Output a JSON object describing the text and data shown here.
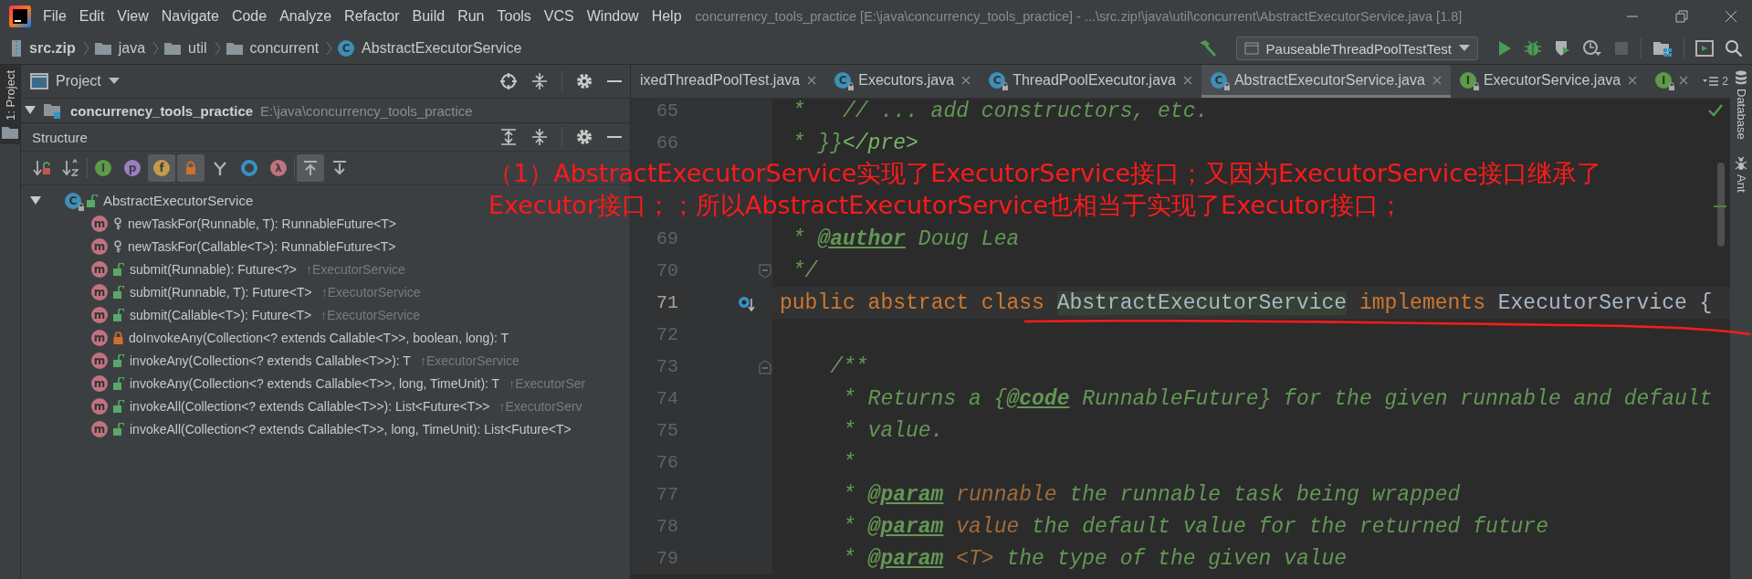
{
  "menu_bar": {
    "items": [
      "File",
      "Edit",
      "View",
      "Navigate",
      "Code",
      "Analyze",
      "Refactor",
      "Build",
      "Run",
      "Tools",
      "VCS",
      "Window",
      "Help"
    ],
    "title": "concurrency_tools_practice [E:\\java\\concurrency_tools_practice] - ...\\src.zip!\\java\\util\\concurrent\\AbstractExecutorService.java [1.8]"
  },
  "nav_bar": {
    "breadcrumbs": [
      {
        "kind": "archive",
        "label": "src.zip"
      },
      {
        "kind": "folder",
        "label": "java"
      },
      {
        "kind": "folder",
        "label": "util"
      },
      {
        "kind": "folder",
        "label": "concurrent"
      },
      {
        "kind": "class",
        "badge": "C",
        "label": "AbstractExecutorService"
      }
    ],
    "run_config": "PauseableThreadPoolTestTest"
  },
  "left_stripe": {
    "tabs": [
      {
        "label": "1: Project",
        "selected": true
      }
    ]
  },
  "project_panel": {
    "title": "Project",
    "root": {
      "name": "concurrency_tools_practice",
      "path": "E:\\java\\concurrency_tools_practice",
      "expanded": true
    }
  },
  "structure_panel": {
    "title": "Structure",
    "toolbar": [
      [
        {
          "kind": "sort-visibility",
          "on": false
        },
        {
          "kind": "sort-alpha",
          "on": false
        }
      ],
      [
        {
          "kind": "inherited",
          "badge": "I",
          "on": false
        },
        {
          "kind": "properties",
          "badge": "p",
          "on": false
        },
        {
          "kind": "fields",
          "badge": "f",
          "on": true
        },
        {
          "kind": "non-public",
          "on": true
        },
        {
          "kind": "anonymous",
          "on": false
        },
        {
          "kind": "ring",
          "on": false
        },
        {
          "kind": "lambdas",
          "badge": "λ",
          "on": false
        }
      ],
      [
        {
          "kind": "scroll-to-source",
          "on": true
        },
        {
          "kind": "scroll-from-source",
          "on": false
        }
      ]
    ],
    "tree": {
      "name": "AbstractExecutorService",
      "badge": "C",
      "expanded": true,
      "children": [
        {
          "badge": "m",
          "kind": "package",
          "name": "newTaskFor(Runnable, T): RunnableFuture<T>"
        },
        {
          "badge": "m",
          "kind": "package",
          "name": "newTaskFor(Callable<T>): RunnableFuture<T>"
        },
        {
          "badge": "m",
          "kind": "public",
          "name": "submit(Runnable): Future<?>",
          "inherited": "↑ExecutorService"
        },
        {
          "badge": "m",
          "kind": "public",
          "name": "submit(Runnable, T): Future<T>",
          "inherited": "↑ExecutorService"
        },
        {
          "badge": "m",
          "kind": "public",
          "name": "submit(Callable<T>): Future<T>",
          "inherited": "↑ExecutorService"
        },
        {
          "badge": "m",
          "kind": "private",
          "name": "doInvokeAny(Collection<? extends Callable<T>>, boolean, long): T"
        },
        {
          "badge": "m",
          "kind": "public",
          "name": "invokeAny(Collection<? extends Callable<T>>): T",
          "inherited": "↑ExecutorService"
        },
        {
          "badge": "m",
          "kind": "public",
          "name": "invokeAny(Collection<? extends Callable<T>>, long, TimeUnit): T",
          "inherited": "↑ExecutorSer"
        },
        {
          "badge": "m",
          "kind": "public",
          "name": "invokeAll(Collection<? extends Callable<T>>): List<Future<T>>",
          "inherited": "↑ExecutorServ"
        },
        {
          "badge": "m",
          "kind": "public",
          "name": "invokeAll(Collection<? extends Callable<T>>, long, TimeUnit): List<Future<T>"
        }
      ]
    }
  },
  "editor": {
    "tabs": [
      {
        "label": "ixedThreadPoolTest.java",
        "selected": false
      },
      {
        "kind": "class",
        "badge": "C",
        "label": "Executors.java",
        "selected": false
      },
      {
        "kind": "class",
        "badge": "C",
        "label": "ThreadPoolExecutor.java",
        "selected": false
      },
      {
        "kind": "class",
        "badge": "C",
        "label": "AbstractExecutorService.java",
        "selected": true
      },
      {
        "kind": "interface",
        "badge": "I",
        "label": "ExecutorService.java",
        "selected": false
      },
      {
        "kind": "interface",
        "badge": "I",
        "selected": false
      }
    ],
    "tab_overflow_count": "2",
    "lines": [
      {
        "number": "65",
        "segments": [
          {
            "kind": "comment",
            "text": " *   // ... add constructors, etc."
          }
        ]
      },
      {
        "number": "66",
        "segments": [
          {
            "kind": "comment",
            "text": " * }}"
          },
          {
            "kind": "markup",
            "text": "</pre>"
          }
        ]
      },
      {
        "covered": true
      },
      {
        "covered": true
      },
      {
        "number": "69",
        "segments": [
          {
            "kind": "comment",
            "text": " * "
          },
          {
            "kind": "doctag",
            "text": "@author"
          },
          {
            "kind": "comment",
            "text": " Doug Lea"
          }
        ]
      },
      {
        "number": "70",
        "fold": {
          "kind": "end"
        },
        "segments": [
          {
            "kind": "comment",
            "text": " */"
          }
        ]
      },
      {
        "number": "71",
        "current": true,
        "gutter_icon": {
          "kind": "implements"
        },
        "segments": [
          {
            "kind": "keyword",
            "text": "public abstract class "
          },
          {
            "kind": "declaration",
            "text": "AbstractExecutorService"
          },
          {
            "kind": "keyword",
            "text": " implements"
          },
          {
            "kind": "plain",
            "text": " ExecutorService {"
          }
        ]
      },
      {
        "number": "72"
      },
      {
        "number": "73",
        "fold": {
          "kind": "start"
        },
        "segments": [
          {
            "kind": "comment",
            "text": "    /**"
          }
        ]
      },
      {
        "number": "74",
        "segments": [
          {
            "kind": "comment",
            "text": "     * Returns a {"
          },
          {
            "kind": "doctag",
            "text": "@code"
          },
          {
            "kind": "comment",
            "text": " RunnableFuture} for the given runnable and default"
          }
        ]
      },
      {
        "number": "75",
        "segments": [
          {
            "kind": "comment",
            "text": "     * value."
          }
        ]
      },
      {
        "number": "76",
        "segments": [
          {
            "kind": "comment",
            "text": "     *"
          }
        ]
      },
      {
        "number": "77",
        "segments": [
          {
            "kind": "comment",
            "text": "     * "
          },
          {
            "kind": "doctag",
            "text": "@param"
          },
          {
            "kind": "param",
            "text": " runnable"
          },
          {
            "kind": "comment",
            "text": " the runnable task being wrapped"
          }
        ]
      },
      {
        "number": "78",
        "segments": [
          {
            "kind": "comment",
            "text": "     * "
          },
          {
            "kind": "doctag",
            "text": "@param"
          },
          {
            "kind": "param",
            "text": " value"
          },
          {
            "kind": "comment",
            "text": " the default value for the returned future"
          }
        ]
      },
      {
        "number": "79",
        "segments": [
          {
            "kind": "comment",
            "text": "     * "
          },
          {
            "kind": "doctag",
            "text": "@param"
          },
          {
            "kind": "param",
            "text": " <T>"
          },
          {
            "kind": "comment",
            "text": " the type of the given value"
          }
        ]
      }
    ]
  },
  "right_stripe": {
    "tabs": [
      {
        "kind": "database",
        "label": "Database"
      },
      {
        "kind": "ant",
        "label": "Ant"
      }
    ]
  },
  "annotation": {
    "lines": [
      "（1）AbstractExecutorService实现了ExecutorService接口；又因为ExecutorService接口继承了",
      "Executor接口；；所以AbstractExecutorService也相当于实现了Executor接口；"
    ]
  }
}
